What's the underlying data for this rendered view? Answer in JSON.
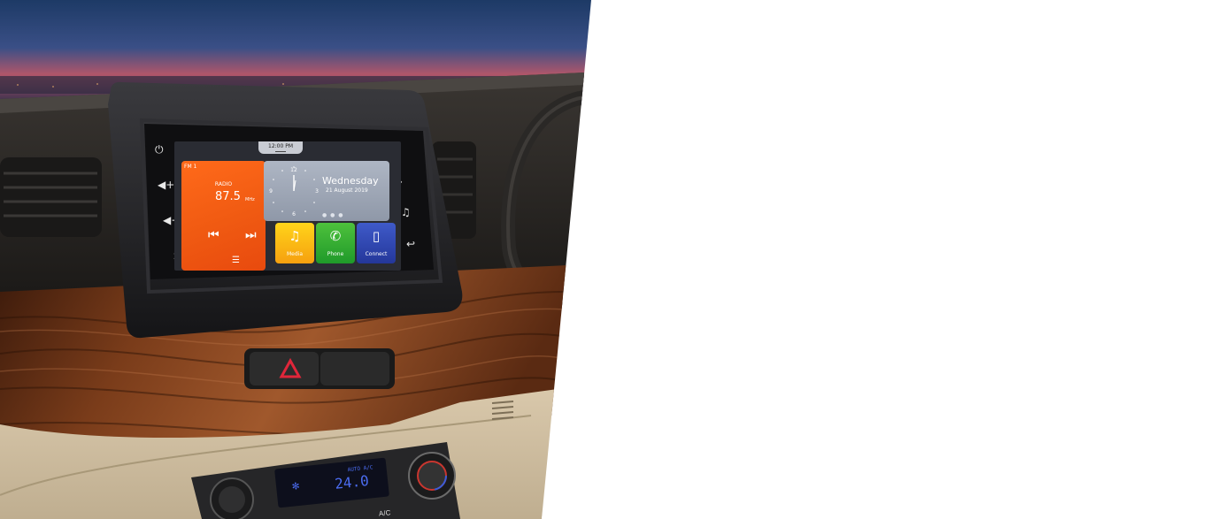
{
  "infotainment": {
    "time": "12:00 PM",
    "radio": {
      "band": "FM 1",
      "source": "RADIO",
      "frequency": "87.5",
      "unit": "MHz"
    },
    "clock": {
      "day": "Wednesday",
      "date": "21 August 2019",
      "numerals": [
        "12",
        "3",
        "6",
        "9"
      ]
    },
    "apps": [
      {
        "label": "Media",
        "icon": "music-note-icon"
      },
      {
        "label": "Phone",
        "icon": "phone-icon"
      },
      {
        "label": "Connect",
        "icon": "smartphone-icon"
      }
    ],
    "left_keys": [
      "power-icon",
      "volume-up-icon",
      "volume-down-icon",
      "mute-icon"
    ],
    "right_keys": [
      "home-icon",
      "navigation-icon",
      "music-note-icon",
      "back-icon"
    ]
  },
  "climate": {
    "temperature": "24.0",
    "mode": "AUTO A/C",
    "button_label": "A/C"
  },
  "colors": {
    "radio_tile": "#f05a12",
    "media_tile": "#f6b50f",
    "phone_tile": "#2fae32",
    "connect_tile": "#2d44b0",
    "wood": "#6a3518",
    "dashboard_beige": "#d8c7a9",
    "climate_display": "#3c5fe0"
  }
}
